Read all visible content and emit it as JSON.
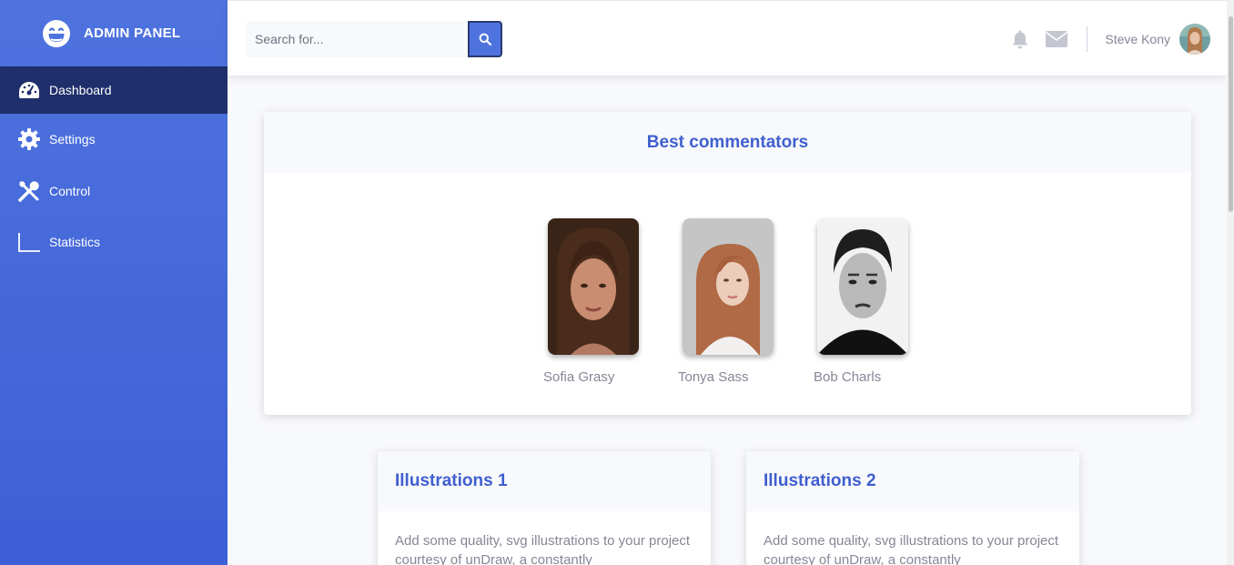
{
  "brand": {
    "title": "ADMIN PANEL",
    "icon": "laugh-icon"
  },
  "sidebar": {
    "items": [
      {
        "label": "Dashboard",
        "icon": "dashboard-gauge-icon",
        "active": true
      },
      {
        "label": "Settings",
        "icon": "gear-icon",
        "active": false
      },
      {
        "label": "Control",
        "icon": "tools-icon",
        "active": false
      },
      {
        "label": "Statistics",
        "icon": "chart-axis-icon",
        "active": false
      }
    ]
  },
  "topbar": {
    "search": {
      "placeholder": "Search for...",
      "value": ""
    },
    "user_name": "Steve Kony"
  },
  "commentators": {
    "title": "Best commentators",
    "people": [
      {
        "name": "Sofia Grasy"
      },
      {
        "name": "Tonya Sass"
      },
      {
        "name": "Bob Charls"
      }
    ]
  },
  "illustrations": [
    {
      "title": "Illustrations 1",
      "body": "Add some quality, svg illustrations to your project courtesy of unDraw, a constantly"
    },
    {
      "title": "Illustrations 2",
      "body": "Add some quality, svg illustrations to your project courtesy of unDraw, a constantly"
    }
  ],
  "colors": {
    "primary": "#4e73df",
    "sidebar_active": "#1f2f6b",
    "text_muted": "#858796"
  }
}
